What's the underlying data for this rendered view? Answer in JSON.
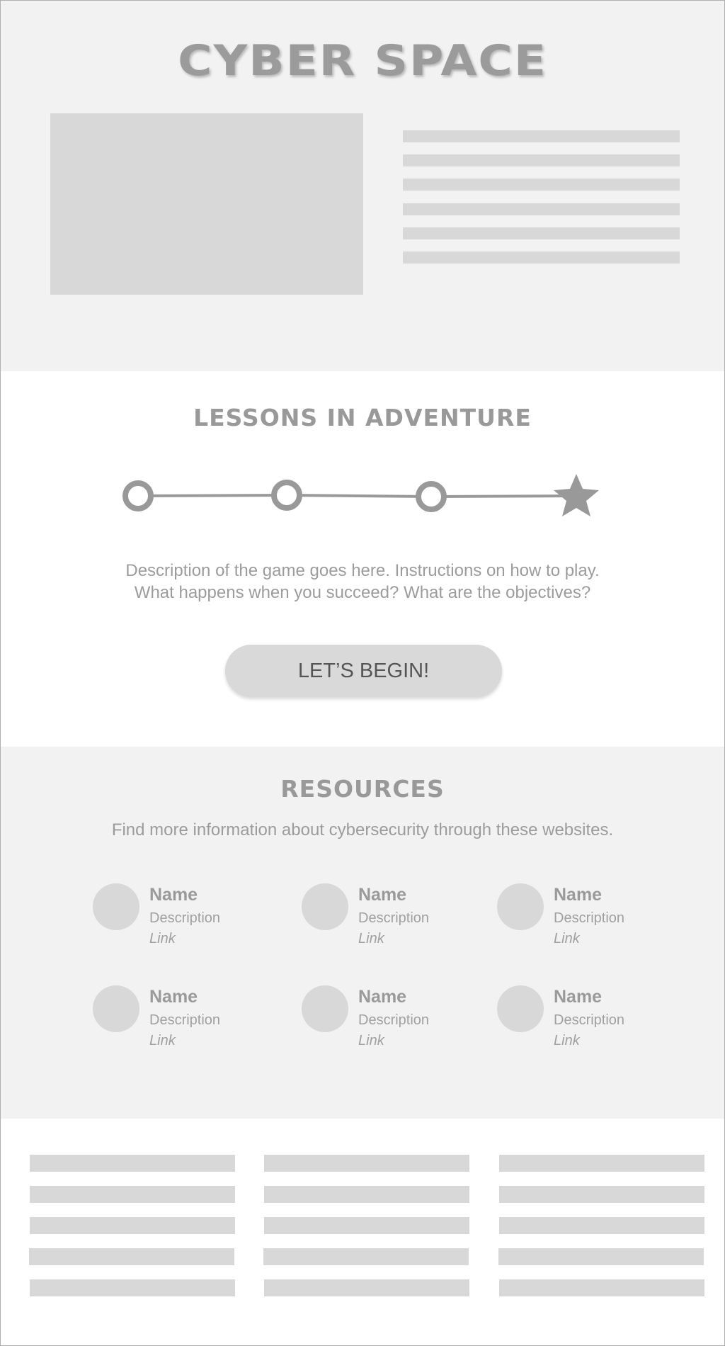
{
  "hero": {
    "title": "CYBER SPACE"
  },
  "lessons": {
    "title": "LESSONS IN ADVENTURE",
    "steps": [
      "step-1",
      "step-2",
      "step-3",
      "goal-star"
    ],
    "description_line1": "Description of the game goes here. Instructions on how to play.",
    "description_line2": "What happens when you succeed? What are the objectives?",
    "button_label": "LET’S BEGIN!"
  },
  "resources": {
    "title": "RESOURCES",
    "subtitle": "Find more information about cybersecurity through these websites.",
    "items": [
      {
        "name": "Name",
        "description": "Description",
        "link": "Link"
      },
      {
        "name": "Name",
        "description": "Description",
        "link": "Link"
      },
      {
        "name": "Name",
        "description": "Description",
        "link": "Link"
      },
      {
        "name": "Name",
        "description": "Description",
        "link": "Link"
      },
      {
        "name": "Name",
        "description": "Description",
        "link": "Link"
      },
      {
        "name": "Name",
        "description": "Description",
        "link": "Link"
      }
    ]
  },
  "colors": {
    "section_gray": "#f2f2f2",
    "placeholder": "#d8d8d8",
    "text_gray": "#9a9a9a",
    "button_text": "#555555"
  }
}
